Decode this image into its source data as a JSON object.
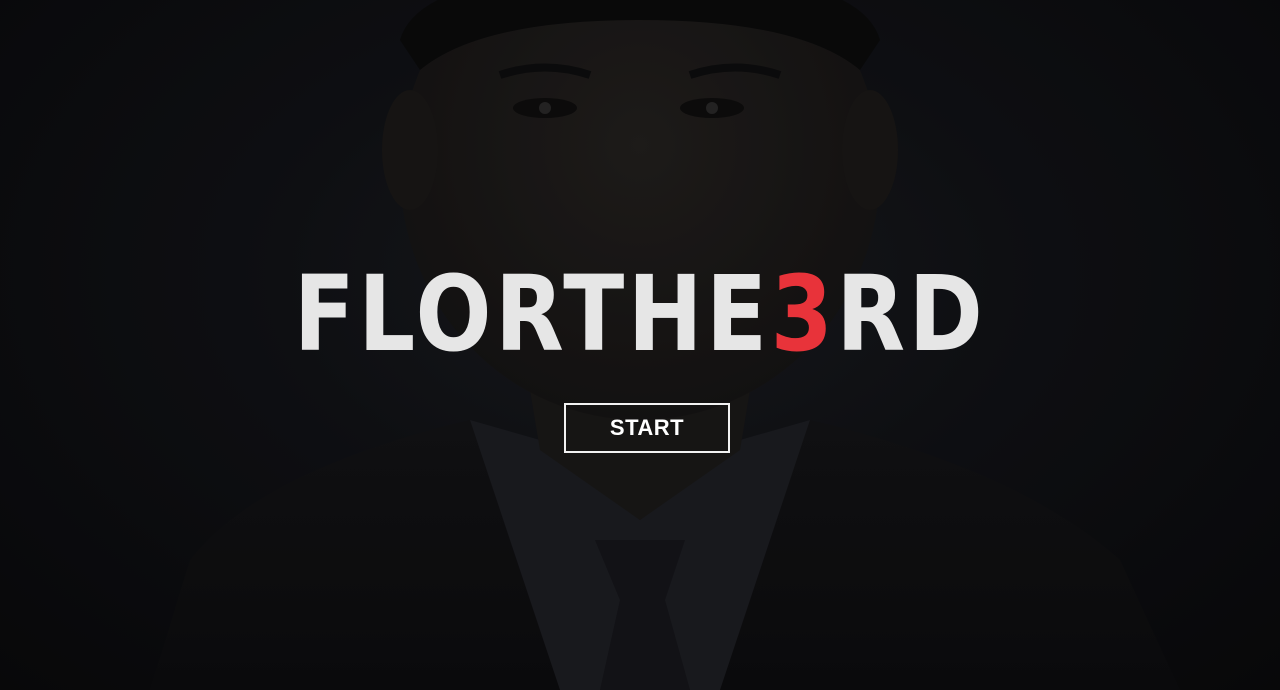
{
  "logo": {
    "part1": "FLORTHE",
    "accent": "3",
    "part2": "RD",
    "text_color": "#e6e6e6",
    "accent_color": "#e8333a"
  },
  "start_button": {
    "label": "START"
  },
  "background": {
    "description_icon": "portrait-photo"
  }
}
